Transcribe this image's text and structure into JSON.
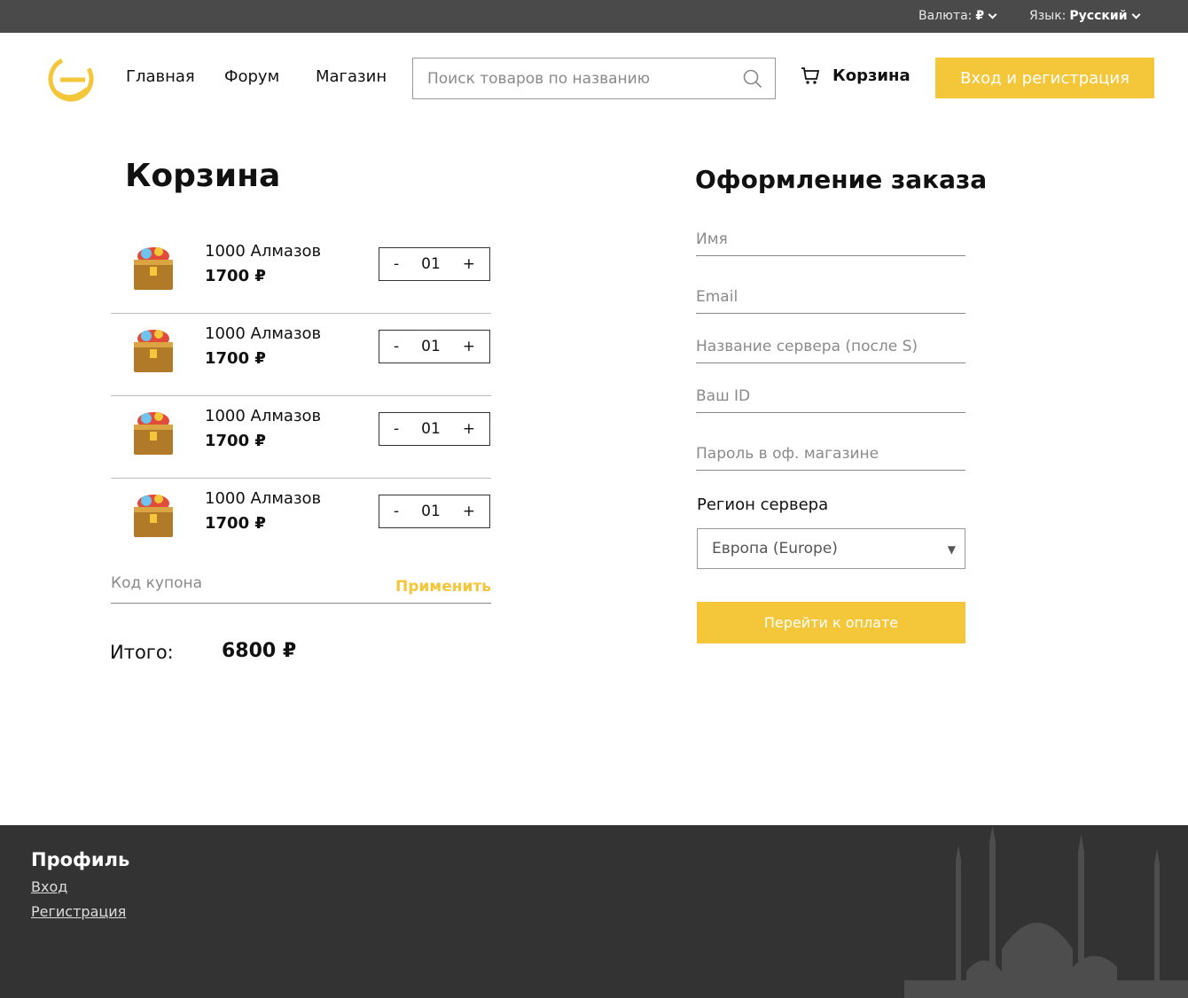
{
  "topbar": {
    "currency_label": "Валюта:",
    "currency_value": "₽",
    "language_label": "Язык:",
    "language_value": "Русский"
  },
  "header": {
    "nav": [
      "Главная",
      "Форум",
      "Магазин"
    ],
    "search_placeholder": "Поиск товаров по названию",
    "cart_label": "Корзина",
    "login_label": "Вход и регистрация"
  },
  "cart": {
    "title": "Корзина",
    "items": [
      {
        "name": "1000 Алмазов",
        "price": "1700 ₽",
        "qty": "01"
      },
      {
        "name": "1000 Алмазов",
        "price": "1700 ₽",
        "qty": "01"
      },
      {
        "name": "1000 Алмазов",
        "price": "1700 ₽",
        "qty": "01"
      },
      {
        "name": "1000 Алмазов",
        "price": "1700 ₽",
        "qty": "01"
      }
    ],
    "minus": "-",
    "plus": "+",
    "coupon_placeholder": "Код купона",
    "apply_label": "Применить",
    "total_label": "Итого:",
    "total_value": "6800 ₽"
  },
  "checkout": {
    "title": "Оформление заказа",
    "fields": [
      "Имя",
      "Email",
      "Название сервера (после S)",
      "Ваш ID",
      "Пароль в оф. магазине"
    ],
    "region_label": "Регион сервера",
    "region_value": "Европа (Europe)",
    "pay_label": "Перейти к оплате"
  },
  "footer": {
    "title": "Профиль",
    "links": [
      "Вход",
      "Регистрация"
    ]
  },
  "colors": {
    "accent": "#f4c63a",
    "topbar": "#4a4a4a",
    "footer": "#333333"
  }
}
